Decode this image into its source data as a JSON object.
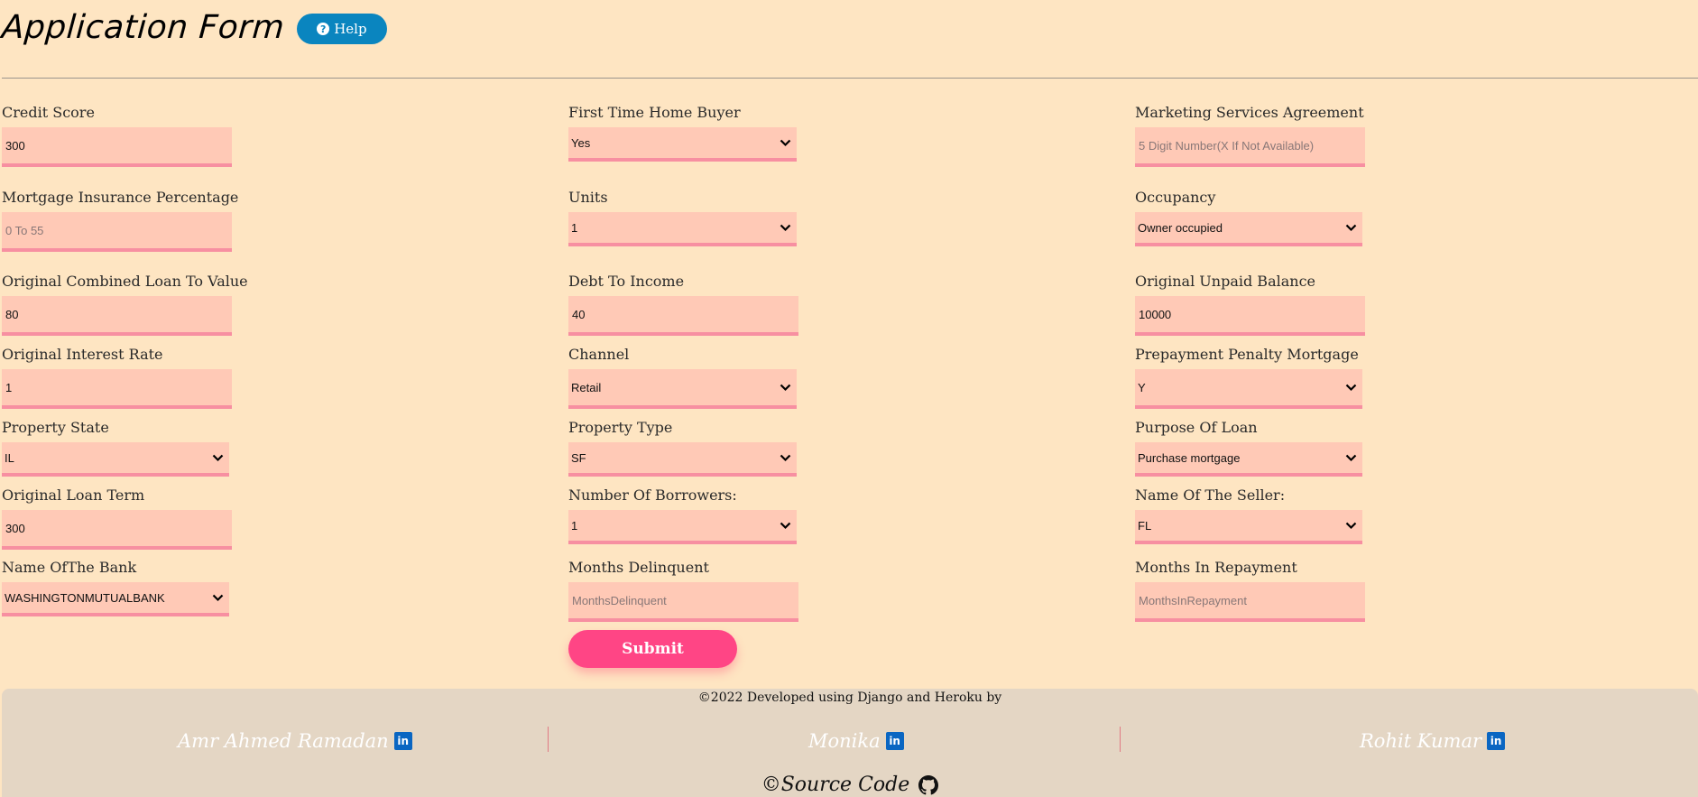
{
  "header": {
    "title": "Application Form",
    "help_label": "Help",
    "help_icon": "question-circle-icon"
  },
  "fields": {
    "credit_score": {
      "label": "Credit Score",
      "value": "300",
      "placeholder": ""
    },
    "first_time_home_buyer": {
      "label": "First Time Home Buyer",
      "value": "Yes"
    },
    "marketing_services_agreement": {
      "label": "Marketing Services Agreement",
      "value": "",
      "placeholder": "5 Digit Number(X If Not Available)"
    },
    "mortgage_insurance_percentage": {
      "label": "Mortgage Insurance Percentage",
      "value": "",
      "placeholder": "0 To 55"
    },
    "units": {
      "label": "Units",
      "value": "1"
    },
    "occupancy": {
      "label": "Occupancy",
      "value": "Owner occupied"
    },
    "original_cltv": {
      "label": "Original Combined Loan To Value",
      "value": "80",
      "placeholder": ""
    },
    "debt_to_income": {
      "label": "Debt To Income",
      "value": "40",
      "placeholder": ""
    },
    "original_unpaid_balance": {
      "label": "Original Unpaid Balance",
      "value": "10000",
      "placeholder": ""
    },
    "original_interest_rate": {
      "label": "Original Interest Rate",
      "value": "1",
      "placeholder": ""
    },
    "channel": {
      "label": "Channel",
      "value": "Retail"
    },
    "prepayment_penalty_mortgage": {
      "label": "Prepayment Penalty Mortgage",
      "value": "Y"
    },
    "property_state": {
      "label": "Property State",
      "value": "IL"
    },
    "property_type": {
      "label": "Property Type",
      "value": "SF"
    },
    "purpose_of_loan": {
      "label": "Purpose Of Loan",
      "value": "Purchase mortgage"
    },
    "original_loan_term": {
      "label": "Original Loan Term",
      "value": "300",
      "placeholder": ""
    },
    "number_of_borrowers": {
      "label": "Number Of Borrowers:",
      "value": "1"
    },
    "name_of_seller": {
      "label": "Name Of The Seller:",
      "value": "FL"
    },
    "name_of_bank": {
      "label": "Name OfThe Bank",
      "value": "WASHINGTONMUTUALBANK"
    },
    "months_delinquent": {
      "label": "Months Delinquent",
      "value": "",
      "placeholder": "MonthsDelinquent"
    },
    "months_in_repayment": {
      "label": "Months In Repayment",
      "value": "",
      "placeholder": "MonthsInRepayment"
    }
  },
  "submit_label": "Submit",
  "footer": {
    "developed_text": "©2022 Developed using Django and Heroku by",
    "authors": [
      "Amr Ahmed Ramadan",
      "Monika",
      "Rohit Kumar"
    ],
    "linkedin_icon_text": "in",
    "source_label": "©Source Code"
  },
  "colors": {
    "background": "#fee5c2",
    "field_bg": "#ffc9b6",
    "field_border": "#f78fa1",
    "submit": "#ff4585",
    "help": "#0a85bf",
    "footer_bg": "#e4d6c4"
  }
}
